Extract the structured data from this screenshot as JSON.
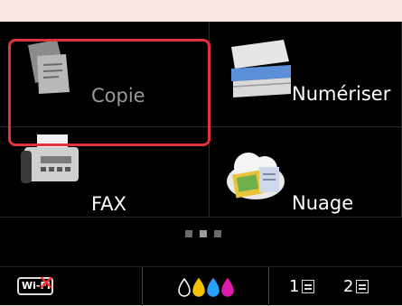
{
  "home": {
    "tiles": [
      {
        "label": "Copie",
        "icon": "copy-documents-icon"
      },
      {
        "label": "Numériser",
        "icon": "scanner-icon"
      },
      {
        "label": "FAX",
        "icon": "fax-machine-icon"
      },
      {
        "label": "Nuage",
        "icon": "cloud-icon"
      }
    ],
    "selected_tile": "Copie",
    "page_indicator": {
      "pages": 3,
      "current": 2
    }
  },
  "status_bar": {
    "wifi_label": "Wi-Fi",
    "wifi_status": "disconnected",
    "ink_colors": [
      "#ffffff",
      "#f2c300",
      "#2aa0ff",
      "#e01aa8"
    ],
    "trays": [
      {
        "label": "1"
      },
      {
        "label": "2"
      }
    ]
  },
  "colors": {
    "selection": "#e2323a",
    "background": "#000000"
  }
}
